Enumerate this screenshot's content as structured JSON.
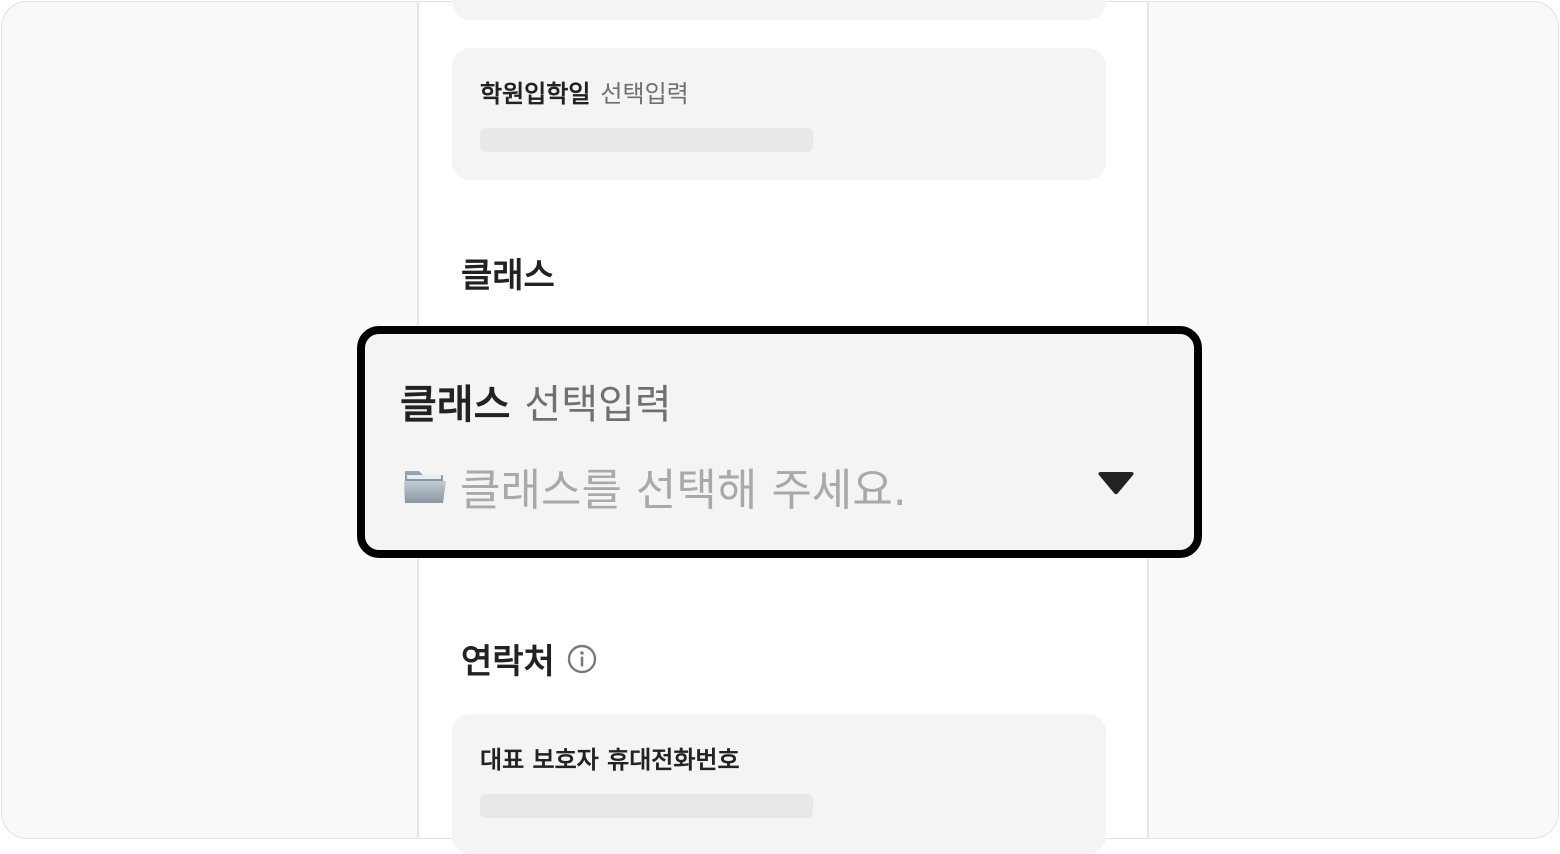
{
  "entry_date": {
    "label": "학원입학일",
    "hint": "선택입력"
  },
  "class_section": {
    "title": "클래스"
  },
  "class_select": {
    "label": "클래스",
    "hint": "선택입력",
    "placeholder": "클래스를 선택해 주세요.",
    "icon": "folder-icon",
    "toggle_icon": "caret-down-icon"
  },
  "contact_section": {
    "title": "연락처",
    "info_icon": "info-icon"
  },
  "guardian_phone": {
    "label": "대표 보호자 휴대전화번호"
  }
}
